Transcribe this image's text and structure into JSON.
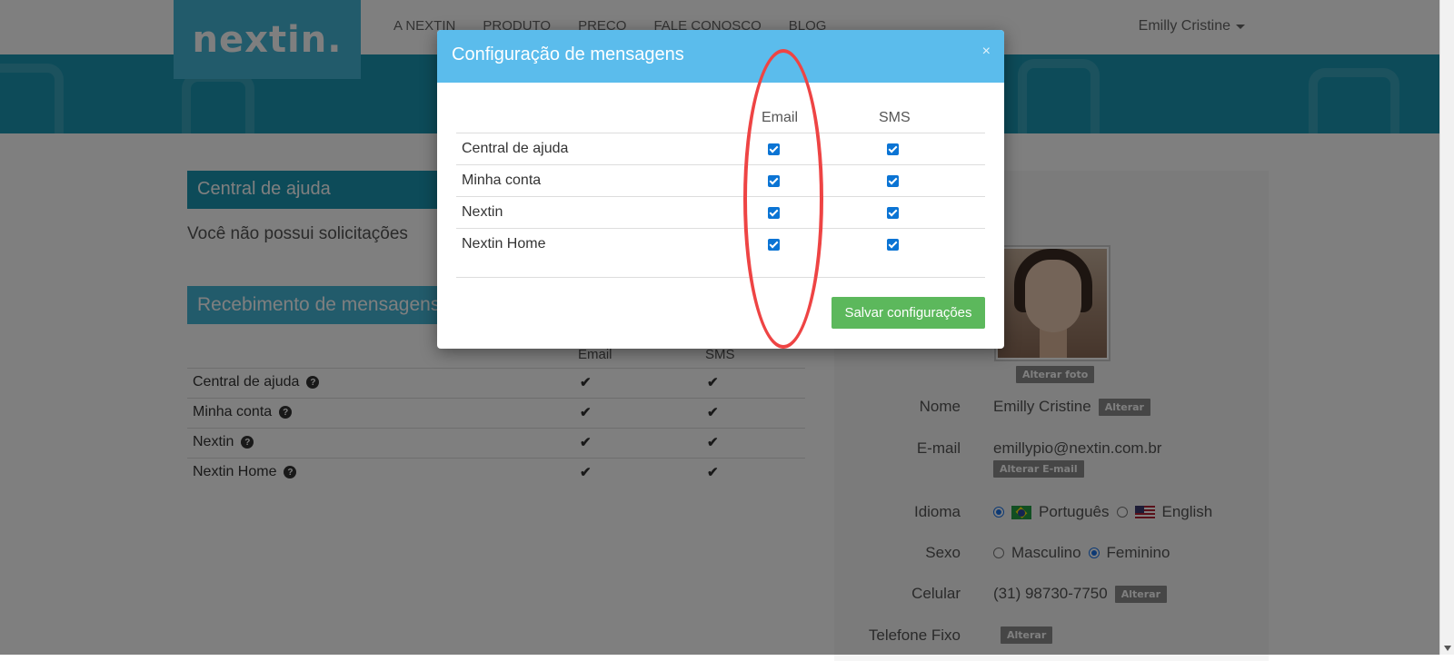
{
  "logo": {
    "text": "nextin."
  },
  "nav": {
    "items": [
      "A NEXTIN",
      "PRODUTO",
      "PREÇO",
      "FALE CONOSCO",
      "BLOG"
    ]
  },
  "user_menu": {
    "name": "Emilly Cristine"
  },
  "help_section": {
    "title": "Central de ajuda",
    "empty_text": "Você não possui solicitações"
  },
  "messages_section": {
    "title": "Recebimento de mensagens",
    "columns": [
      "Email",
      "SMS"
    ],
    "rows": [
      "Central de ajuda",
      "Minha conta",
      "Nextin",
      "Nextin Home"
    ]
  },
  "profile": {
    "change_photo": "Alterar foto",
    "name_label": "Nome",
    "name_value": "Emilly Cristine",
    "change_label": "Alterar",
    "email_label": "E-mail",
    "email_value": "emillypio@nextin.com.br",
    "change_email": "Alterar E-mail",
    "language_label": "Idioma",
    "language_options": [
      "Português",
      "English"
    ],
    "language_selected": "Português",
    "sex_label": "Sexo",
    "sex_options": [
      "Masculino",
      "Feminino"
    ],
    "sex_selected": "Feminino",
    "mobile_label": "Celular",
    "mobile_value": "(31) 98730-7750",
    "landline_label": "Telefone Fixo"
  },
  "modal": {
    "title": "Configuração de mensagens",
    "close": "×",
    "columns": [
      "Email",
      "SMS"
    ],
    "rows": [
      {
        "label": "Central de ajuda",
        "email": true,
        "sms": true
      },
      {
        "label": "Minha conta",
        "email": true,
        "sms": true
      },
      {
        "label": "Nextin",
        "email": true,
        "sms": true
      },
      {
        "label": "Nextin Home",
        "email": true,
        "sms": true
      }
    ],
    "save_button": "Salvar configurações"
  },
  "colors": {
    "banner": "#1b97b3",
    "modal_header": "#5bbcec",
    "save_button": "#5cb85c",
    "annotation": "#ee4444"
  }
}
